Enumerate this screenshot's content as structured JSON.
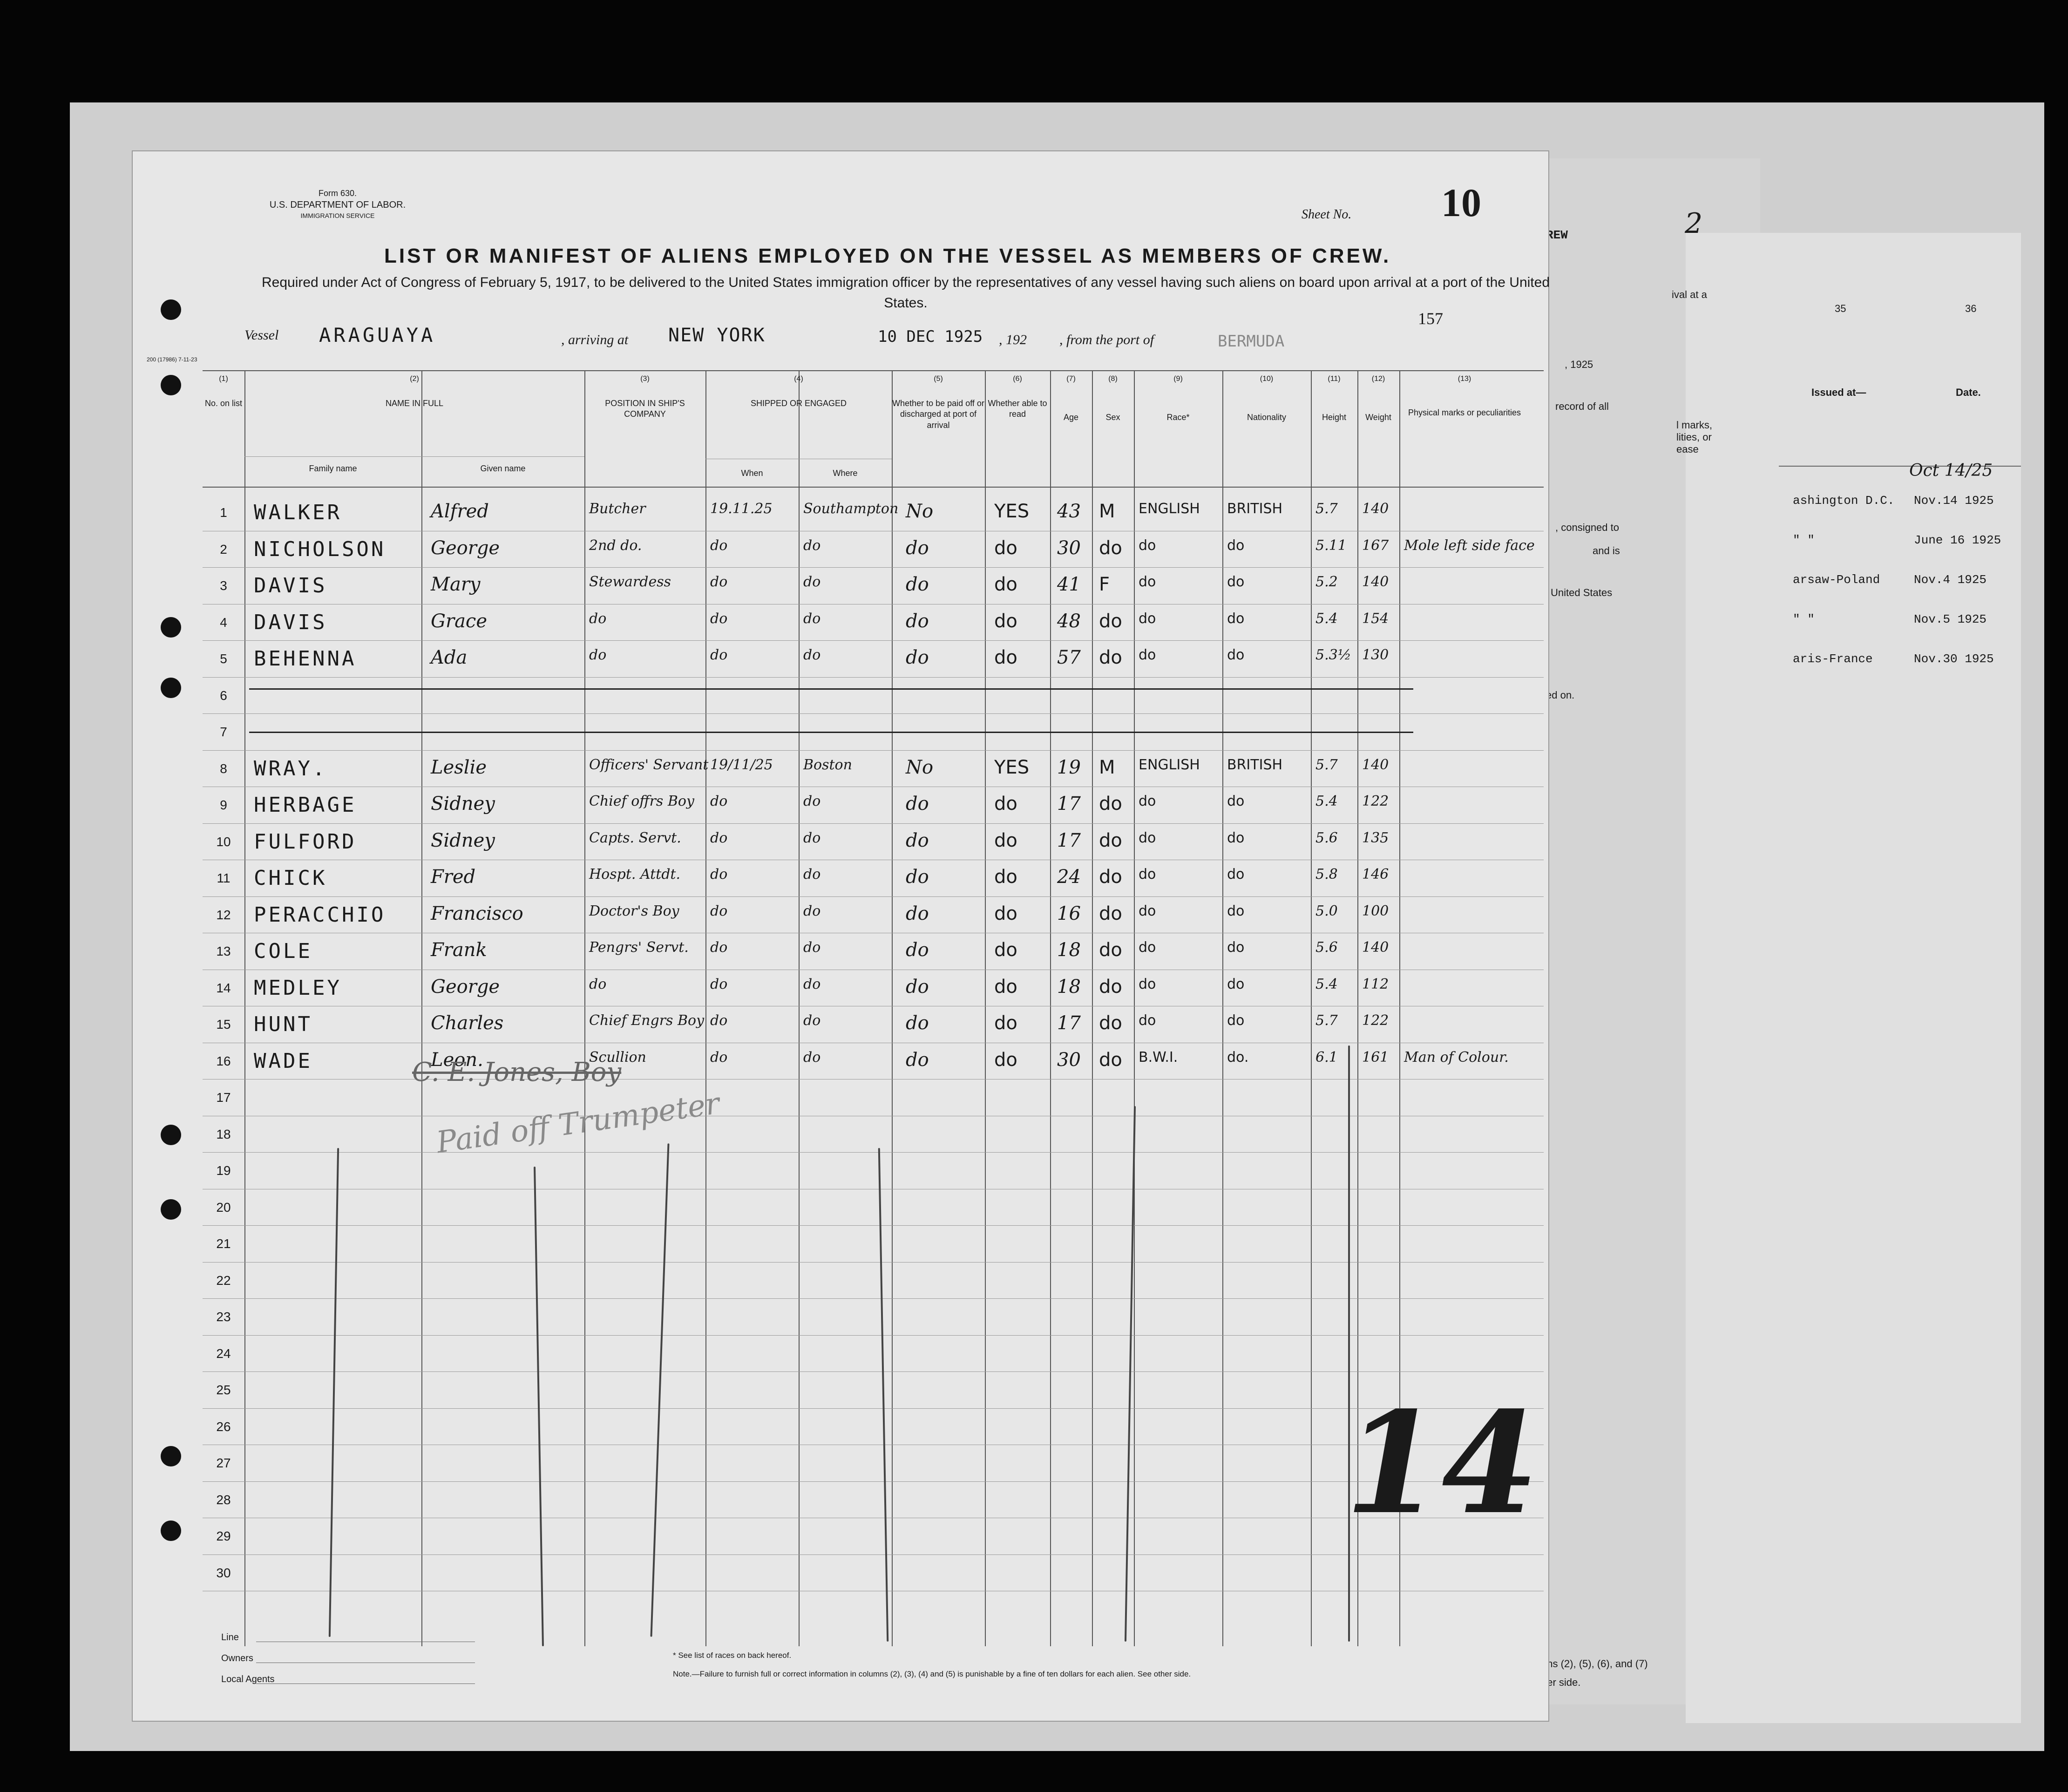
{
  "form": {
    "number": "Form 630.",
    "department": "U.S. DEPARTMENT OF LABOR.",
    "service": "IMMIGRATION SERVICE",
    "print_code": "200 (17986) 7-11-23",
    "title": "LIST OR MANIFEST OF ALIENS EMPLOYED ON THE VESSEL AS MEMBERS OF CREW.",
    "subtitle": "Required under Act of Congress of February 5, 1917, to be delivered to the United States immigration officer by the representatives of any vessel having such aliens on board upon arrival at a port of the United States.",
    "sheet_label": "Sheet No.",
    "sheet_number": "10",
    "page_mark": "157"
  },
  "voyage": {
    "vessel_label": "Vessel",
    "vessel": "ARAGUAYA",
    "arriving_label": ", arriving at",
    "arriving_at": "NEW YORK",
    "date_stamp": "10 DEC 1925",
    "year_label": ", 192",
    "from_label": ", from the port of",
    "from_port": "BERMUDA"
  },
  "columns": {
    "nums": [
      "(1)",
      "(2)",
      "(3)",
      "(4)",
      "(5)",
      "(6)",
      "(7)",
      "(8)",
      "(9)",
      "(10)",
      "(11)",
      "(12)",
      "(13)"
    ],
    "no_on_list": "No. on list",
    "name_in_full": "NAME IN FULL",
    "family_name": "Family name",
    "given_name": "Given name",
    "position": "POSITION IN SHIP'S COMPANY",
    "shipped": "SHIPPED OR ENGAGED",
    "when": "When",
    "where": "Where",
    "paid_off": "Whether to be paid off or discharged at port of arrival",
    "able_to_read": "Whether able to read",
    "age": "Age",
    "sex": "Sex",
    "race": "Race*",
    "nationality": "Nationality",
    "height": "Height",
    "weight": "Weight",
    "marks": "Physical marks or peculiarities"
  },
  "rows": [
    {
      "n": "1",
      "family": "WALKER",
      "given": "Alfred",
      "position": "Butcher",
      "when": "19.11.25",
      "where": "Southampton",
      "paid": "No",
      "read": "YES",
      "age": "43",
      "sex": "M",
      "race": "ENGLISH",
      "nat": "BRITISH",
      "height": "5.7",
      "weight": "140",
      "marks": ""
    },
    {
      "n": "2",
      "family": "NICHOLSON",
      "given": "George",
      "position": "2nd do.",
      "when": "do",
      "where": "do",
      "paid": "do",
      "read": "do",
      "age": "30",
      "sex": "do",
      "race": "do",
      "nat": "do",
      "height": "5.11",
      "weight": "167",
      "marks": "Mole left side face"
    },
    {
      "n": "3",
      "family": "DAVIS",
      "given": "Mary",
      "position": "Stewardess",
      "when": "do",
      "where": "do",
      "paid": "do",
      "read": "do",
      "age": "41",
      "sex": "F",
      "race": "do",
      "nat": "do",
      "height": "5.2",
      "weight": "140",
      "marks": ""
    },
    {
      "n": "4",
      "family": "DAVIS",
      "given": "Grace",
      "position": "do",
      "when": "do",
      "where": "do",
      "paid": "do",
      "read": "do",
      "age": "48",
      "sex": "do",
      "race": "do",
      "nat": "do",
      "height": "5.4",
      "weight": "154",
      "marks": ""
    },
    {
      "n": "5",
      "family": "BEHENNA",
      "given": "Ada",
      "position": "do",
      "when": "do",
      "where": "do",
      "paid": "do",
      "read": "do",
      "age": "57",
      "sex": "do",
      "race": "do",
      "nat": "do",
      "height": "5.3½",
      "weight": "130",
      "marks": ""
    },
    {
      "n": "6",
      "family": "",
      "given": "",
      "position": "",
      "when": "",
      "where": "",
      "paid": "",
      "read": "",
      "age": "",
      "sex": "",
      "race": "",
      "nat": "",
      "height": "",
      "weight": "",
      "marks": ""
    },
    {
      "n": "7",
      "family": "",
      "given": "",
      "position": "",
      "when": "",
      "where": "",
      "paid": "",
      "read": "",
      "age": "",
      "sex": "",
      "race": "",
      "nat": "",
      "height": "",
      "weight": "",
      "marks": ""
    },
    {
      "n": "8",
      "family": "WRAY.",
      "given": "Leslie",
      "position": "Officers' Servant",
      "when": "19/11/25",
      "where": "Boston",
      "paid": "No",
      "read": "YES",
      "age": "19",
      "sex": "M",
      "race": "ENGLISH",
      "nat": "BRITISH",
      "height": "5.7",
      "weight": "140",
      "marks": ""
    },
    {
      "n": "9",
      "family": "HERBAGE",
      "given": "Sidney",
      "position": "Chief offrs Boy",
      "when": "do",
      "where": "do",
      "paid": "do",
      "read": "do",
      "age": "17",
      "sex": "do",
      "race": "do",
      "nat": "do",
      "height": "5.4",
      "weight": "122",
      "marks": ""
    },
    {
      "n": "10",
      "family": "FULFORD",
      "given": "Sidney",
      "position": "Capts. Servt.",
      "when": "do",
      "where": "do",
      "paid": "do",
      "read": "do",
      "age": "17",
      "sex": "do",
      "race": "do",
      "nat": "do",
      "height": "5.6",
      "weight": "135",
      "marks": ""
    },
    {
      "n": "11",
      "family": "CHICK",
      "given": "Fred",
      "position": "Hospt. Attdt.",
      "when": "do",
      "where": "do",
      "paid": "do",
      "read": "do",
      "age": "24",
      "sex": "do",
      "race": "do",
      "nat": "do",
      "height": "5.8",
      "weight": "146",
      "marks": ""
    },
    {
      "n": "12",
      "family": "PERACCHIO",
      "given": "Francisco",
      "position": "Doctor's Boy",
      "when": "do",
      "where": "do",
      "paid": "do",
      "read": "do",
      "age": "16",
      "sex": "do",
      "race": "do",
      "nat": "do",
      "height": "5.0",
      "weight": "100",
      "marks": ""
    },
    {
      "n": "13",
      "family": "COLE",
      "given": "Frank",
      "position": "Pengrs' Servt.",
      "when": "do",
      "where": "do",
      "paid": "do",
      "read": "do",
      "age": "18",
      "sex": "do",
      "race": "do",
      "nat": "do",
      "height": "5.6",
      "weight": "140",
      "marks": ""
    },
    {
      "n": "14",
      "family": "MEDLEY",
      "given": "George",
      "position": "do",
      "when": "do",
      "where": "do",
      "paid": "do",
      "read": "do",
      "age": "18",
      "sex": "do",
      "race": "do",
      "nat": "do",
      "height": "5.4",
      "weight": "112",
      "marks": ""
    },
    {
      "n": "15",
      "family": "HUNT",
      "given": "Charles",
      "position": "Chief Engrs Boy",
      "when": "do",
      "where": "do",
      "paid": "do",
      "read": "do",
      "age": "17",
      "sex": "do",
      "race": "do",
      "nat": "do",
      "height": "5.7",
      "weight": "122",
      "marks": ""
    },
    {
      "n": "16",
      "family": "WADE",
      "given": "Leon.",
      "position": "Scullion",
      "when": "do",
      "where": "do",
      "paid": "do",
      "read": "do",
      "age": "30",
      "sex": "do",
      "race": "B.W.I.",
      "nat": "do.",
      "height": "6.1",
      "weight": "161",
      "marks": "Man of Colour."
    },
    {
      "n": "17",
      "family": "",
      "given": "",
      "position": "",
      "when": "",
      "where": "",
      "paid": "",
      "read": "",
      "age": "",
      "sex": "",
      "race": "",
      "nat": "",
      "height": "",
      "weight": "",
      "marks": ""
    },
    {
      "n": "18",
      "family": "",
      "given": "",
      "position": "",
      "when": "",
      "where": "",
      "paid": "",
      "read": "",
      "age": "",
      "sex": "",
      "race": "",
      "nat": "",
      "height": "",
      "weight": "",
      "marks": ""
    },
    {
      "n": "19",
      "family": "",
      "given": "",
      "position": "",
      "when": "",
      "where": "",
      "paid": "",
      "read": "",
      "age": "",
      "sex": "",
      "race": "",
      "nat": "",
      "height": "",
      "weight": "",
      "marks": ""
    },
    {
      "n": "20",
      "family": "",
      "given": "",
      "position": "",
      "when": "",
      "where": "",
      "paid": "",
      "read": "",
      "age": "",
      "sex": "",
      "race": "",
      "nat": "",
      "height": "",
      "weight": "",
      "marks": ""
    },
    {
      "n": "21",
      "family": "",
      "given": "",
      "position": "",
      "when": "",
      "where": "",
      "paid": "",
      "read": "",
      "age": "",
      "sex": "",
      "race": "",
      "nat": "",
      "height": "",
      "weight": "",
      "marks": ""
    },
    {
      "n": "22",
      "family": "",
      "given": "",
      "position": "",
      "when": "",
      "where": "",
      "paid": "",
      "read": "",
      "age": "",
      "sex": "",
      "race": "",
      "nat": "",
      "height": "",
      "weight": "",
      "marks": ""
    },
    {
      "n": "23",
      "family": "",
      "given": "",
      "position": "",
      "when": "",
      "where": "",
      "paid": "",
      "read": "",
      "age": "",
      "sex": "",
      "race": "",
      "nat": "",
      "height": "",
      "weight": "",
      "marks": ""
    },
    {
      "n": "24",
      "family": "",
      "given": "",
      "position": "",
      "when": "",
      "where": "",
      "paid": "",
      "read": "",
      "age": "",
      "sex": "",
      "race": "",
      "nat": "",
      "height": "",
      "weight": "",
      "marks": ""
    },
    {
      "n": "25",
      "family": "",
      "given": "",
      "position": "",
      "when": "",
      "where": "",
      "paid": "",
      "read": "",
      "age": "",
      "sex": "",
      "race": "",
      "nat": "",
      "height": "",
      "weight": "",
      "marks": ""
    },
    {
      "n": "26",
      "family": "",
      "given": "",
      "position": "",
      "when": "",
      "where": "",
      "paid": "",
      "read": "",
      "age": "",
      "sex": "",
      "race": "",
      "nat": "",
      "height": "",
      "weight": "",
      "marks": ""
    },
    {
      "n": "27",
      "family": "",
      "given": "",
      "position": "",
      "when": "",
      "where": "",
      "paid": "",
      "read": "",
      "age": "",
      "sex": "",
      "race": "",
      "nat": "",
      "height": "",
      "weight": "",
      "marks": ""
    },
    {
      "n": "28",
      "family": "",
      "given": "",
      "position": "",
      "when": "",
      "where": "",
      "paid": "",
      "read": "",
      "age": "",
      "sex": "",
      "race": "",
      "nat": "",
      "height": "",
      "weight": "",
      "marks": ""
    },
    {
      "n": "29",
      "family": "",
      "given": "",
      "position": "",
      "when": "",
      "where": "",
      "paid": "",
      "read": "",
      "age": "",
      "sex": "",
      "race": "",
      "nat": "",
      "height": "",
      "weight": "",
      "marks": ""
    },
    {
      "n": "30",
      "family": "",
      "given": "",
      "position": "",
      "when": "",
      "where": "",
      "paid": "",
      "read": "",
      "age": "",
      "sex": "",
      "race": "",
      "nat": "",
      "height": "",
      "weight": "",
      "marks": ""
    }
  ],
  "annotations": {
    "crossed_line": "C. E. Jones, Boy",
    "pencil_note": "Paid off Trumpeter",
    "big_mark": "14"
  },
  "footer": {
    "line": "Line",
    "owners": "Owners",
    "local_agents": "Local Agents",
    "race_note": "* See list of races on back hereof.",
    "penalty_note": "Note.—Failure to furnish full or correct information in columns (2), (3), (4) and (5) is punishable by a fine of ten dollars for each alien. See other side."
  },
  "back_sheet": {
    "crew_fragment": "REW",
    "page_num": "2",
    "arrival_fragment": "ival at a",
    "col35": "35",
    "col36": "36",
    "issued_at": "Issued at—",
    "date": "Date.",
    "record_fragment": "record of all",
    "year_fragment": ", 1925",
    "consigned_fragment": ", consigned to",
    "and_is_fragment": "and is",
    "us_fragment": "United States",
    "ed_on_fragment": "ed on.",
    "marks_fragment": "l marks, lities, or ease",
    "entries": [
      {
        "place": "ashington D.C.",
        "date": "Nov.14 1925"
      },
      {
        "place": "\"      \"",
        "date": "June 16 1925"
      },
      {
        "place": "arsaw-Poland",
        "date": "Nov.4 1925"
      },
      {
        "place": "\"      \"",
        "date": "Nov.5 1925"
      },
      {
        "place": "aris-France",
        "date": "Nov.30 1925"
      }
    ],
    "pencil_date": "Oct 14/25",
    "bottom_fragment": "ons (2), (5), (6), and (7)",
    "bottom_fragment2": "her side."
  }
}
